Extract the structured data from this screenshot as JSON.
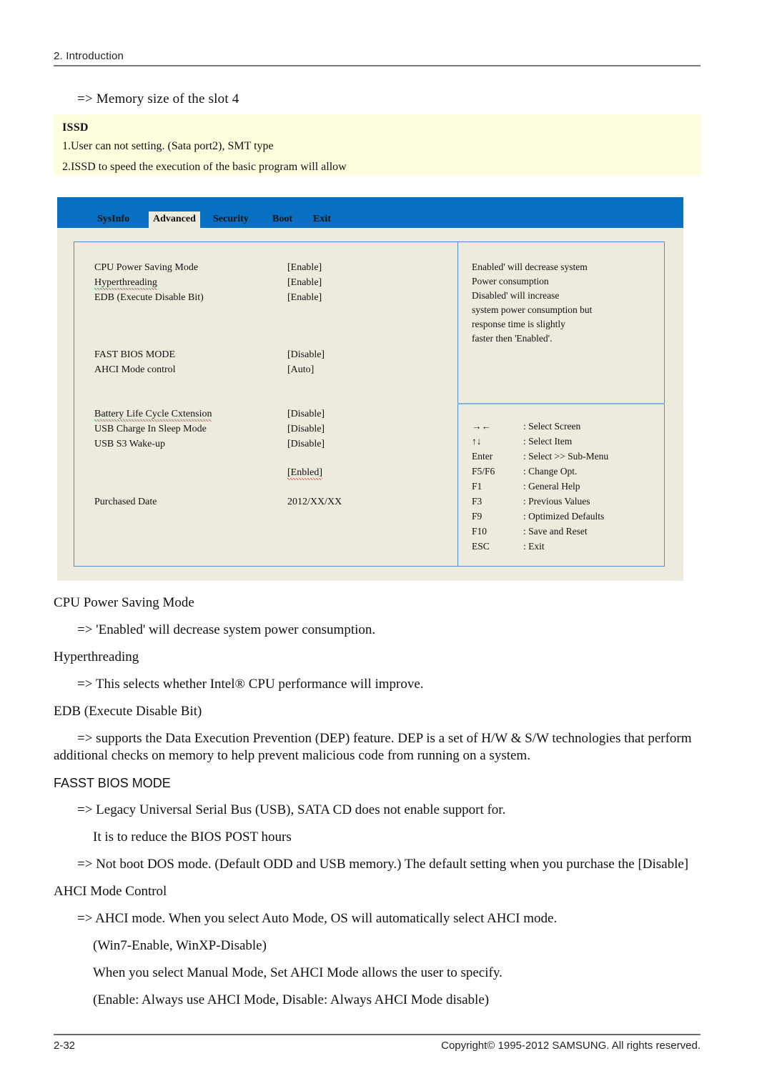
{
  "page": {
    "header_title": "2.  Introduction",
    "intro_line": "=> Memory size of the slot 4",
    "footer_page_number": "2-32",
    "footer_copyright": "Copyright© 1995-2012 SAMSUNG. All rights reserved."
  },
  "issd_note": {
    "title": "ISSD",
    "line1": "1.User can not setting. (Sata port2), SMT type",
    "line2": "2.ISSD to speed the execution of the basic program will allow",
    "background_color": "#ffffdf"
  },
  "bios": {
    "header_color": "#0770c2",
    "panel_color": "#edeade",
    "border_color": "#4b8fce",
    "tabs": [
      {
        "label": "SysInfo",
        "active": false
      },
      {
        "label": "Advanced",
        "active": true
      },
      {
        "label": "Security",
        "active": false
      },
      {
        "label": "Boot",
        "active": false
      },
      {
        "label": "Exit",
        "active": false
      }
    ],
    "settings": [
      {
        "label": "CPU Power Saving Mode",
        "value": "[Enable]",
        "misspelled": false
      },
      {
        "label": "Hyperthreading",
        "value": "[Enable]",
        "misspelled": true
      },
      {
        "label": "EDB (Execute Disable Bit)",
        "value": "[Enable]",
        "misspelled": false
      },
      {
        "label": "FAST BIOS MODE",
        "value": "[Disable]",
        "misspelled": false
      },
      {
        "label": "AHCI Mode control",
        "value": "[Auto]",
        "misspelled": false
      },
      {
        "label": "Battery Life Cycle Cxtension",
        "value": "[Disable]",
        "misspelled": true
      },
      {
        "label": "USB Charge In Sleep Mode",
        "value": "[Disable]",
        "misspelled": false
      },
      {
        "label": "USB S3 Wake-up",
        "value": "[Disable]",
        "misspelled": false
      },
      {
        "label": "",
        "value": "[Enbled]",
        "misspelled": true
      },
      {
        "label": "Purchased Date",
        "value": "2012/XX/XX",
        "misspelled": false
      }
    ],
    "help_lines": [
      "Enabled' will decrease system",
      "Power consumption",
      "Disabled' will increase",
      "system power consumption but",
      "response time is slightly",
      "faster then 'Enabled'."
    ],
    "key_legend": [
      {
        "key": "→←",
        "desc": ": Select Screen"
      },
      {
        "key": "↑↓",
        "desc": ": Select Item"
      },
      {
        "key": "Enter",
        "desc": ": Select >> Sub-Menu"
      },
      {
        "key": "F5/F6",
        "desc": ": Change Opt."
      },
      {
        "key": "F1",
        "desc": ": General Help"
      },
      {
        "key": "F3",
        "desc": ": Previous Values"
      },
      {
        "key": "F9",
        "desc": ": Optimized Defaults"
      },
      {
        "key": "F10",
        "desc": ": Save and Reset"
      },
      {
        "key": "ESC",
        "desc": ": Exit"
      }
    ]
  },
  "body": [
    {
      "text": "CPU Power Saving Mode",
      "indent": 0,
      "sans": false
    },
    {
      "text": "=> 'Enabled' will decrease system power consumption.",
      "indent": 33,
      "sans": false
    },
    {
      "text": "Hyperthreading",
      "indent": 0,
      "sans": false
    },
    {
      "text": "=> This selects whether Intel® CPU performance will improve.",
      "indent": 33,
      "sans": false
    },
    {
      "text": "EDB (Execute Disable Bit)",
      "indent": 0,
      "sans": false
    },
    {
      "text": "=> supports the Data Execution Prevention (DEP) feature.  DEP is a set of H/W & S/W technologies that perform",
      "indent": 33,
      "sans": false
    },
    {
      "text": "additional checks on memory to help prevent malicious code from running on a system.",
      "indent": 0,
      "sans": false
    },
    {
      "text": "FASST BIOS MODE",
      "indent": 0,
      "sans": true
    },
    {
      "text": "=>  Legacy Universal Serial Bus (USB), SATA CD does not enable support for.",
      "indent": 33,
      "sans": false
    },
    {
      "text": "It is to reduce the BIOS POST hours",
      "indent": 55,
      "sans": false
    },
    {
      "text": "=> Not boot DOS mode. (Default ODD and USB memory.) The default setting when      you purchase the [Disable]",
      "indent": 33,
      "sans": false
    },
    {
      "text": "AHCI Mode Control",
      "indent": 0,
      "sans": false
    },
    {
      "text": "=> AHCI mode.  When you select Auto Mode, OS will automatically select AHCI mode.",
      "indent": 33,
      "sans": false
    },
    {
      "text": "(Win7-Enable, WinXP-Disable)",
      "indent": 55,
      "sans": false
    },
    {
      "text": "When you select Manual Mode, Set AHCI Mode allows the user to specify.",
      "indent": 55,
      "sans": false
    },
    {
      "text": "(Enable: Always use AHCI Mode, Disable: Always AHCI Mode disable)",
      "indent": 55,
      "sans": false
    }
  ]
}
